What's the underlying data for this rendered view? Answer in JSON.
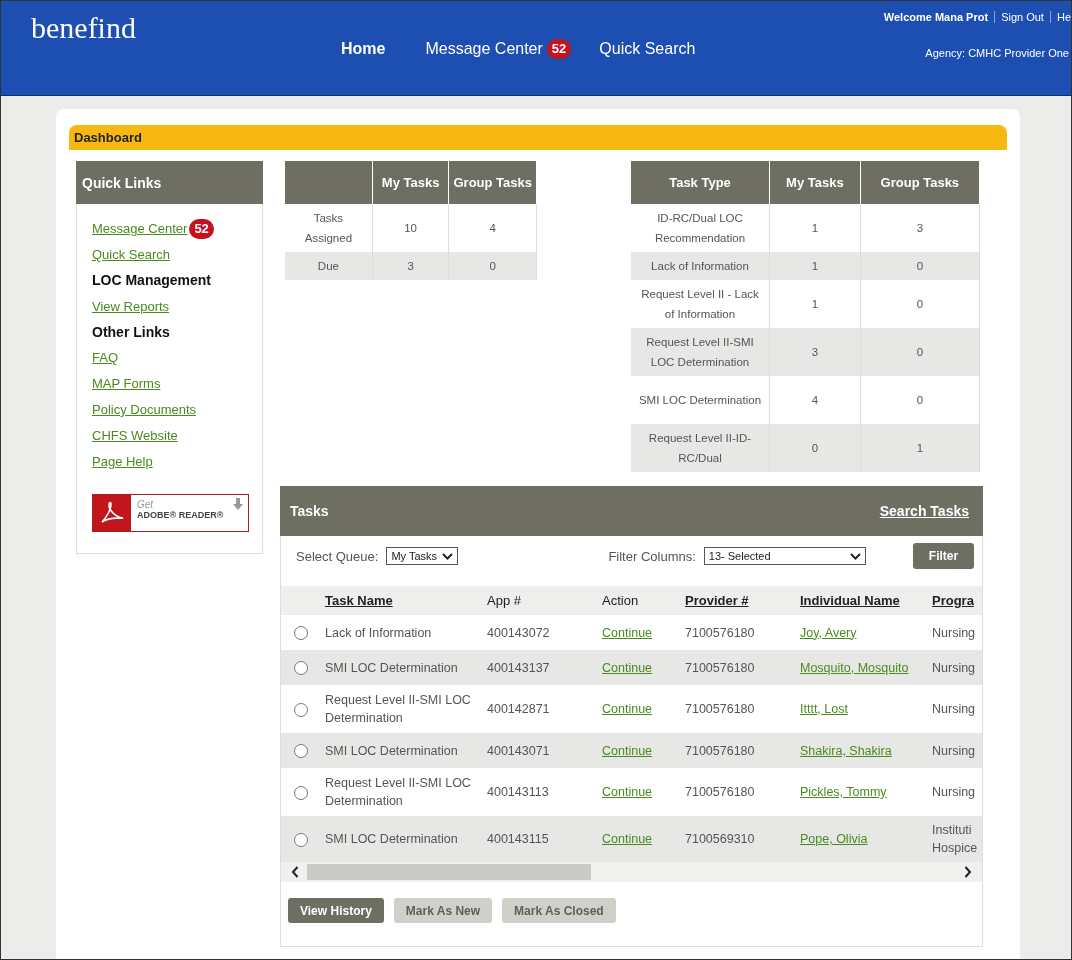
{
  "header": {
    "logo": "benefind",
    "nav": [
      {
        "label": "Home",
        "selected": true
      },
      {
        "label": "Message Center",
        "badge": "52",
        "selected": false
      },
      {
        "label": "Quick Search",
        "selected": false
      }
    ],
    "welcome": "Welcome Mana Prot",
    "links": [
      "Sign Out",
      "He"
    ],
    "agency": "Agency: CMHC Provider One"
  },
  "dashboard": {
    "title": "Dashboard"
  },
  "quick_links": {
    "title": "Quick Links",
    "items": [
      {
        "kind": "link",
        "label": "Message Center",
        "badge": "52"
      },
      {
        "kind": "link",
        "label": "Quick Search"
      },
      {
        "kind": "heading",
        "label": "LOC Management"
      },
      {
        "kind": "link",
        "label": "View Reports"
      },
      {
        "kind": "heading",
        "label": "Other Links"
      },
      {
        "kind": "link",
        "label": "FAQ"
      },
      {
        "kind": "link",
        "label": "MAP Forms"
      },
      {
        "kind": "link",
        "label": "Policy Documents"
      },
      {
        "kind": "link",
        "label": "CHFS Website"
      },
      {
        "kind": "link",
        "label": "Page Help"
      }
    ],
    "adobe": {
      "line1": "Get",
      "line2": "ADOBE® READER®"
    }
  },
  "summary_table": {
    "columns": [
      "",
      "My Tasks",
      "Group Tasks"
    ],
    "rows": [
      [
        "Tasks Assigned",
        "10",
        "4"
      ],
      [
        "Due",
        "3",
        "0"
      ]
    ]
  },
  "task_type_table": {
    "columns": [
      "Task Type",
      "My Tasks",
      "Group Tasks"
    ],
    "rows": [
      [
        "ID-RC/Dual LOC Recommendation",
        "1",
        "3"
      ],
      [
        "Lack of Information",
        "1",
        "0"
      ],
      [
        "Request Level II - Lack of Information",
        "1",
        "0"
      ],
      [
        "Request Level II-SMI LOC Determination",
        "3",
        "0"
      ],
      [
        "SMI LOC Determination",
        "4",
        "0"
      ],
      [
        "Request Level II-ID-RC/Dual",
        "0",
        "1"
      ]
    ]
  },
  "tasks": {
    "title": "Tasks",
    "search_link": "Search Tasks",
    "queue_label": "Select Queue:",
    "queue_value": "My Tasks",
    "filter_label": "Filter Columns:",
    "filter_value": "13- Selected",
    "filter_button": "Filter",
    "columns": [
      {
        "label": "Task Name",
        "sortable": true
      },
      {
        "label": "App #",
        "sortable": false
      },
      {
        "label": "Action",
        "sortable": false
      },
      {
        "label": "Provider #",
        "sortable": true
      },
      {
        "label": "Individual Name",
        "sortable": true
      },
      {
        "label": "Progra",
        "sortable": true
      }
    ],
    "rows": [
      {
        "selected": false,
        "task": "Lack of Information",
        "app": "400143072",
        "action": "Continue",
        "provider": "7100576180",
        "name": "Joy, Avery",
        "program": "Nursing"
      },
      {
        "selected": false,
        "task": "SMI LOC Determination",
        "app": "400143137",
        "action": "Continue",
        "provider": "7100576180",
        "name": "Mosquito, Mosquito",
        "program": "Nursing"
      },
      {
        "selected": false,
        "task": "Request Level II-SMI LOC Determination",
        "app": "400142871",
        "action": "Continue",
        "provider": "7100576180",
        "name": "Itttt, Lost",
        "program": "Nursing"
      },
      {
        "selected": false,
        "task": "SMI LOC Determination",
        "app": "400143071",
        "action": "Continue",
        "provider": "7100576180",
        "name": "Shakira, Shakira",
        "program": "Nursing"
      },
      {
        "selected": false,
        "task": "Request Level II-SMI LOC Determination",
        "app": "400143113",
        "action": "Continue",
        "provider": "7100576180",
        "name": "Pickles, Tommy",
        "program": "Nursing"
      },
      {
        "selected": false,
        "task": "SMI LOC Determination",
        "app": "400143115",
        "action": "Continue",
        "provider": "7100569310",
        "name": "Pope, Olivia",
        "program": "Instituti Hospice"
      }
    ],
    "buttons": [
      {
        "label": "View History",
        "disabled": false
      },
      {
        "label": "Mark As New",
        "disabled": true
      },
      {
        "label": "Mark As Closed",
        "disabled": true
      }
    ]
  }
}
